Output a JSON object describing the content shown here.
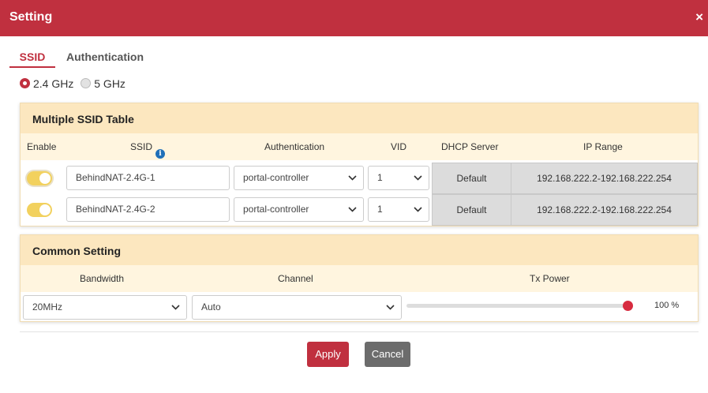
{
  "dialog": {
    "title": "Setting",
    "close_label": "×"
  },
  "tabs": [
    {
      "label": "SSID",
      "active": true
    },
    {
      "label": "Authentication",
      "active": false
    }
  ],
  "band": {
    "options": [
      {
        "label": "2.4 GHz",
        "selected": true
      },
      {
        "label": "5 GHz",
        "selected": false
      }
    ]
  },
  "ssid_table": {
    "title": "Multiple SSID Table",
    "columns": {
      "enable": "Enable",
      "ssid": "SSID",
      "authentication": "Authentication",
      "vid": "VID",
      "dhcp": "DHCP Server",
      "ip_range": "IP Range"
    },
    "info_icon": "i",
    "rows": [
      {
        "enabled": true,
        "ssid": "BehindNAT-2.4G-1",
        "authentication": "portal-controller",
        "vid": "1",
        "dhcp": "Default",
        "ip_range": "192.168.222.2-192.168.222.254"
      },
      {
        "enabled": true,
        "ssid": "BehindNAT-2.4G-2",
        "authentication": "portal-controller",
        "vid": "1",
        "dhcp": "Default",
        "ip_range": "192.168.222.2-192.168.222.254"
      }
    ]
  },
  "common_setting": {
    "title": "Common Setting",
    "columns": {
      "bandwidth": "Bandwidth",
      "channel": "Channel",
      "tx_power": "Tx Power"
    },
    "bandwidth": "20MHz",
    "channel": "Auto",
    "tx_power_percent": 100,
    "tx_power_label": "100 %"
  },
  "buttons": {
    "apply": "Apply",
    "cancel": "Cancel"
  },
  "colors": {
    "brand": "#c0303f",
    "toggle_on": "#f2d15e",
    "panel_header": "#fce7bf",
    "slider_knob": "#d72b3f"
  },
  "icons": {
    "close": "close-icon",
    "info": "info-icon",
    "chevron": "chevron-down-icon"
  }
}
